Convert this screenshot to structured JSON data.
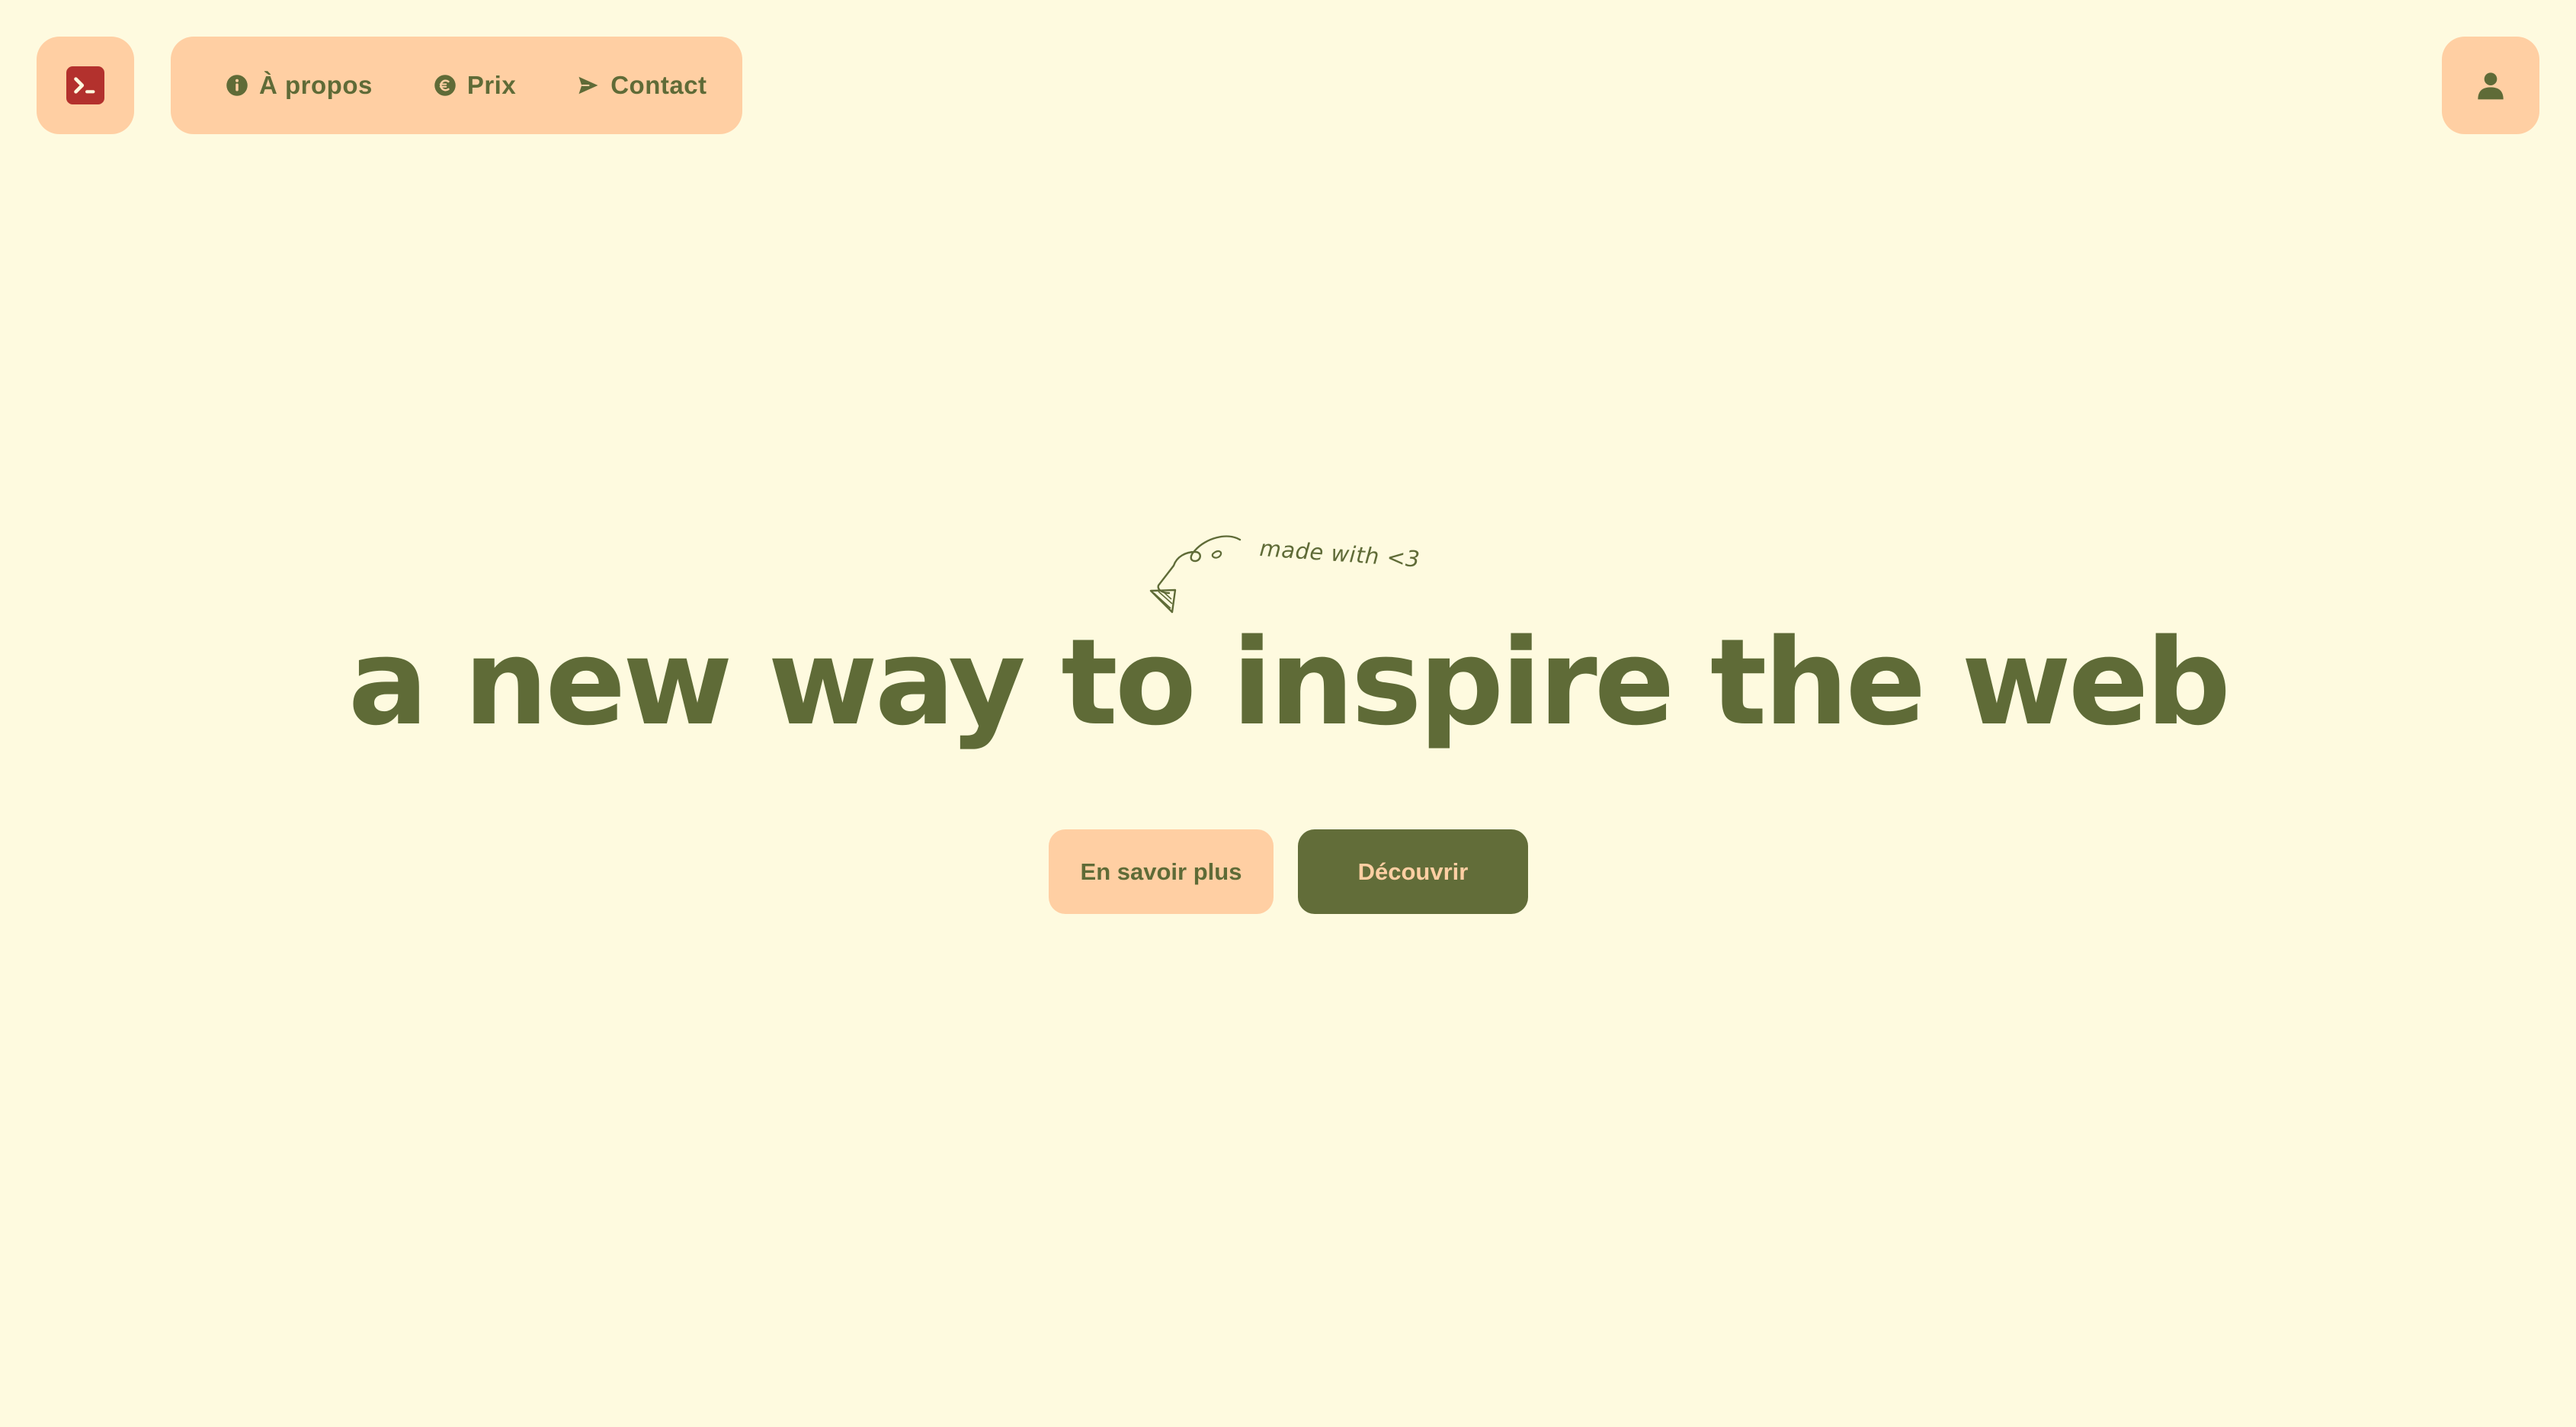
{
  "colors": {
    "background": "#fefadf",
    "accent_peach": "#ffcfa3",
    "olive_primary": "#5f6b37",
    "logo_red": "#b3312d"
  },
  "header": {
    "logo": {
      "icon": "terminal-icon"
    },
    "nav": [
      {
        "label": "À propos",
        "icon": "info-circle-icon"
      },
      {
        "label": "Prix",
        "icon": "euro-circle-icon"
      },
      {
        "label": "Contact",
        "icon": "paper-plane-icon"
      }
    ],
    "account": {
      "icon": "user-icon"
    }
  },
  "hero": {
    "tagline": "made with <3",
    "tagline_icon": "hand-drawn-arrow-icon",
    "headline": "a new way to inspire the web",
    "secondary_cta": "En savoir plus",
    "primary_cta": "Découvrir"
  }
}
